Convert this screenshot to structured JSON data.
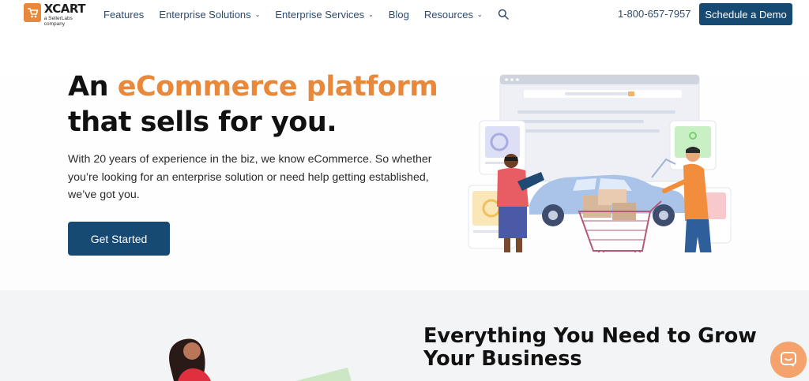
{
  "brand": {
    "name": "XCART",
    "tagline": "a SellerLabs company",
    "accent_color": "#e8883a",
    "primary_color": "#174a72"
  },
  "nav": {
    "items": [
      {
        "label": "Features",
        "has_dropdown": false
      },
      {
        "label": "Enterprise Solutions",
        "has_dropdown": true
      },
      {
        "label": "Enterprise Services",
        "has_dropdown": true
      },
      {
        "label": "Blog",
        "has_dropdown": false
      },
      {
        "label": "Resources",
        "has_dropdown": true
      }
    ],
    "search_icon": "search-icon",
    "phone": "1-800-657-7957",
    "demo_label": "Schedule a Demo"
  },
  "hero": {
    "title_part1": "An",
    "title_accent": "eCommerce platform",
    "title_line2": "that sells for you.",
    "lead": "With 20 years of experience in the biz, we know eCommerce. So whether you’re looking for an enterprise solution or need help getting established, we’ve got you.",
    "cta_label": "Get Started"
  },
  "section2": {
    "title_line1": "Everything You Need to Grow",
    "title_line2": "Your Business"
  },
  "chat": {
    "icon": "chat-icon"
  }
}
